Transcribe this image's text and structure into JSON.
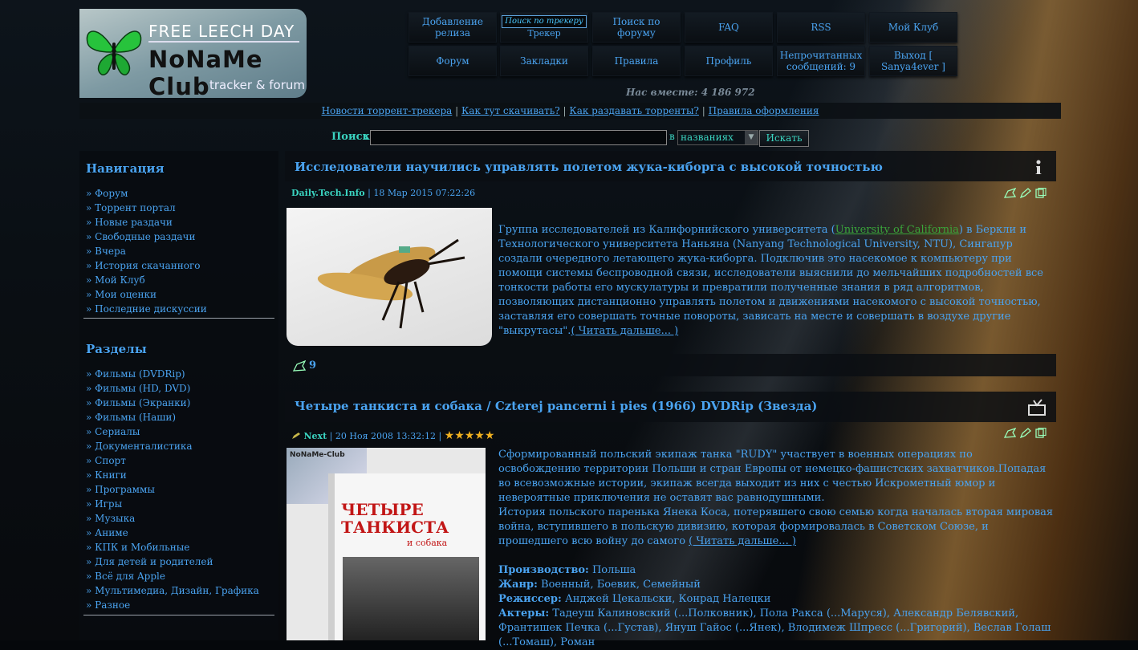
{
  "logo": {
    "banner": "FREE LEECH DAY",
    "name": "NoNaMe Club",
    "tagline": "tracker & forum"
  },
  "topmenu": {
    "add_release": "Добавление релиза",
    "tracker_search_placeholder": "Поиск по трекеру",
    "tracker": "Трекер",
    "forum_search": "Поиск по форуму",
    "faq": "FAQ",
    "rss": "RSS",
    "my_club": "Мой Клуб",
    "forum": "Форум",
    "bookmarks": "Закладки",
    "rules": "Правила",
    "profile": "Профиль",
    "unread": "Непрочитанных сообщений: 9",
    "logout": "Выход [ Sanya4ever ]"
  },
  "together": "Нас вместе: 4 186 972",
  "links": {
    "news": "Новости торрент-трекера",
    "how_download": "Как тут скачивать?",
    "how_seed": "Как раздавать торренты?",
    "design_rules": "Правила оформления"
  },
  "search": {
    "label": "Поиск",
    "in_label": "в",
    "field": "названиях",
    "button": "Искать"
  },
  "sidebar": {
    "nav_title": "Навигация",
    "nav_items": [
      "» Форум",
      "» Торрент портал",
      "» Новые раздачи",
      "» Свободные раздачи",
      "» Вчера",
      "» История скачанного",
      "» Мой Клуб",
      "» Мои оценки",
      "» Последние дискуссии"
    ],
    "sections_title": "Разделы",
    "sections": [
      "» Фильмы (DVDRip)",
      "» Фильмы (HD, DVD)",
      "» Фильмы (Экранки)",
      "» Фильмы (Наши)",
      "» Сериалы",
      "» Документалистика",
      "» Спорт",
      "» Книги",
      "» Программы",
      "» Игры",
      "» Музыка",
      "» Аниме",
      "» КПК и Мобильные",
      "» Для детей и родителей",
      "» Всё для Apple",
      "» Мультимедиа, Дизайн, Графика",
      "» Разное"
    ]
  },
  "article1": {
    "title": "Исследователи научились управлять полетом жука-киборга с высокой точностью",
    "source": "Daily.Tech.Info",
    "date": "18 Мар 2015 07:22:26",
    "text_before": "Группа исследователей из Калифорнийского университета (",
    "link_uc": "University of California",
    "text_after": ") в Беркли и Технологического университета Наньяна (Nanyang Technological University, NTU), Сингапур создали очередного летающего жука-киборга. Подключив это насекомое к компьютеру при помощи системы беспроводной связи, исследователи выяснили до мельчайших подробностей все тонкости работы его мускулатуры и превратили полученные знания в ряд алгоритмов, позволяющих дистанционно управлять полетом и движениями насекомого с высокой точностью, заставляя его совершать точные повороты, зависать на месте и совершать в воздухе другие \"выкрутасы\".",
    "read_more": "( Читать дальше... )",
    "comments": "9"
  },
  "article2": {
    "title": "Четыре танкиста и собака / Czterej pancerni i pies (1966) DVDRip (Звезда)",
    "author": "Next",
    "date": "20 Ноя 2008 13:32:12",
    "rating": "★★★★★",
    "para1": "Сформированный польский экипаж танка \"RUDY\" участвует в военных операциях по освобождению территории Польши и стран Европы от немецко-фашистских захватчиков.Попадая во всевозможные истории, экипаж всегда выходит из них с честью Искрометный юмор и невероятные приключения не оставят вас равнодушными.",
    "para2": "История польского паренька Янека Коса, потерявшего свою семью когда началась вторая мировая война, вступившего в польскую дивизию, которая формировалась в Советском Союзе, и прошедшего всю войну до самого",
    "read_more": "( Читать дальше... )",
    "country_label": "Производство:",
    "country": "Польша",
    "genre_label": "Жанр:",
    "genre": "Военный, Боевик, Семейный",
    "director_label": "Режиссер:",
    "director": "Анджей Цекальски, Конрад Налецки",
    "actors_label": "Актеры:",
    "actors": "Тадеуш Калиновский (...Полковник), Пола Ракса (...Маруся), Александр Белявский, Франтишек Печка (...Густав), Януш Гайос (...Янек), Влодимеж Шпресс (...Григорий), Веслав Голаш (...Томаш), Роман",
    "poster_logo": "NoNaMe-Club",
    "poster_title": "ЧЕТЫРЕ ТАНКИСТА",
    "poster_sub": "и собака"
  }
}
